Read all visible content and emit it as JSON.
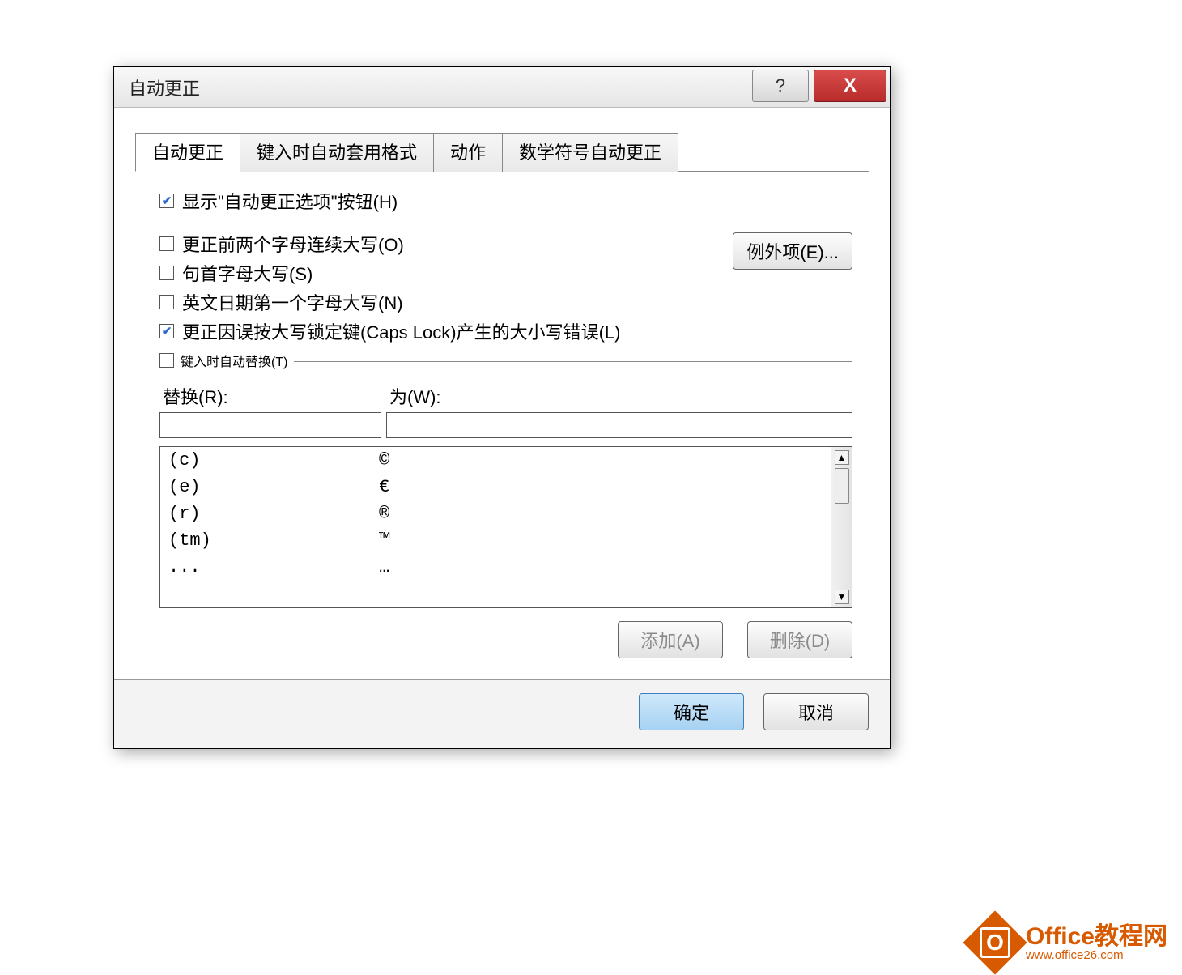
{
  "dialog": {
    "title": "自动更正"
  },
  "tabs": {
    "t0": "自动更正",
    "t1": "键入时自动套用格式",
    "t2": "动作",
    "t3": "数学符号自动更正"
  },
  "options": {
    "show_button": "显示\"自动更正选项\"按钮(H)",
    "two_initial_caps": "更正前两个字母连续大写(O)",
    "capitalize_sentence": "句首字母大写(S)",
    "capitalize_days": "英文日期第一个字母大写(N)",
    "caps_lock": "更正因误按大写锁定键(Caps Lock)产生的大小写错误(L)",
    "replace_as_type": "键入时自动替换(T)"
  },
  "buttons": {
    "exceptions": "例外项(E)...",
    "add": "添加(A)",
    "delete": "删除(D)",
    "ok": "确定",
    "cancel": "取消"
  },
  "fields": {
    "replace_label": "替换(R):",
    "with_label": "为(W):"
  },
  "list": [
    {
      "replace": "(c)",
      "with": "©"
    },
    {
      "replace": "(e)",
      "with": "€"
    },
    {
      "replace": "(r)",
      "with": "®"
    },
    {
      "replace": "(tm)",
      "with": "™"
    },
    {
      "replace": "...",
      "with": "…"
    }
  ],
  "watermark": {
    "line1": "Office教程网",
    "line2": "www.office26.com"
  }
}
